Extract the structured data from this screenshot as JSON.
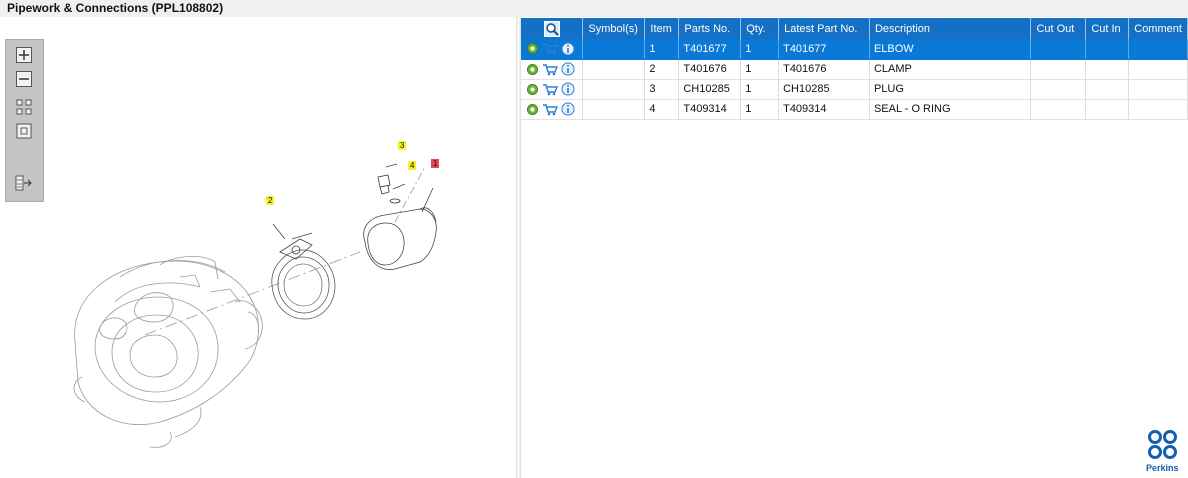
{
  "window": {
    "title": "Pipework & Connections (PPL108802)"
  },
  "toolbar": {
    "buttons": [
      {
        "name": "zoom-in-icon"
      },
      {
        "name": "zoom-out-icon"
      },
      {
        "name": "fit-all-icon"
      },
      {
        "name": "fit-window-icon"
      },
      {
        "name": "export-icon"
      }
    ]
  },
  "diagram": {
    "callouts": [
      {
        "label": "1",
        "color": "#e8434f"
      },
      {
        "label": "2",
        "color": "#f4f12a"
      },
      {
        "label": "3",
        "color": "#f4f12a"
      },
      {
        "label": "4",
        "color": "#f4f12a"
      }
    ]
  },
  "table": {
    "header_icon": "zoom-search-icon",
    "columns": [
      "Symbol(s)",
      "Item",
      "Parts No.",
      "Qty.",
      "Latest Part No.",
      "Description",
      "Cut Out",
      "Cut In",
      "Comment"
    ],
    "rows": [
      {
        "item": "1",
        "part_no": "T401677",
        "qty": "1",
        "latest": "T401677",
        "description": "ELBOW",
        "cut_out": "",
        "cut_in": "",
        "comment": "",
        "selected": true
      },
      {
        "item": "2",
        "part_no": "T401676",
        "qty": "1",
        "latest": "T401676",
        "description": "CLAMP",
        "cut_out": "",
        "cut_in": "",
        "comment": "",
        "selected": false
      },
      {
        "item": "3",
        "part_no": "CH10285",
        "qty": "1",
        "latest": "CH10285",
        "description": "PLUG",
        "cut_out": "",
        "cut_in": "",
        "comment": "",
        "selected": false
      },
      {
        "item": "4",
        "part_no": "T409314",
        "qty": "1",
        "latest": "T409314",
        "description": "SEAL - O RING",
        "cut_out": "",
        "cut_in": "",
        "comment": "",
        "selected": false
      }
    ],
    "row_icons": [
      "gear-icon",
      "cart-icon",
      "info-icon"
    ]
  },
  "brand": {
    "name": "Perkins",
    "color": "#1160ae"
  },
  "colors": {
    "header_bg": "#1470c4",
    "selected_row": "#0a78d7"
  }
}
